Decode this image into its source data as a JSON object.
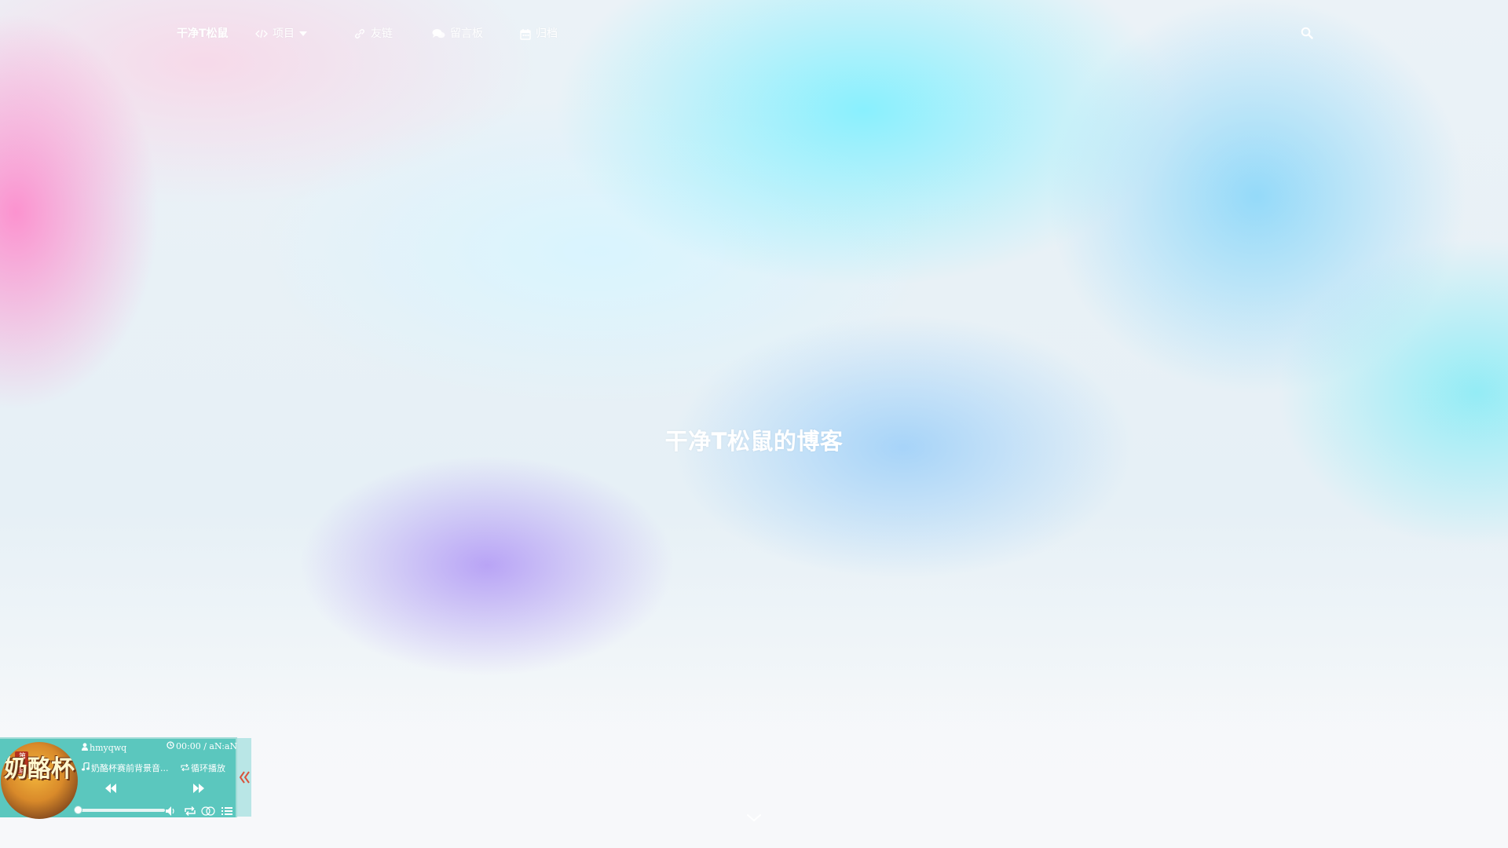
{
  "nav": {
    "brand": "干净T松鼠",
    "items": [
      {
        "label": "项目",
        "icon": "code-icon",
        "has_dropdown": true
      },
      {
        "label": "友链",
        "icon": "link-icon"
      },
      {
        "label": "留言板",
        "icon": "comments-icon"
      },
      {
        "label": "归档",
        "icon": "calendar-icon"
      }
    ],
    "search_icon": "search-icon"
  },
  "hero": {
    "title": "干净T松鼠的博客"
  },
  "player": {
    "cover_text": "奶酪杯",
    "cover_tag": "第五届",
    "artist": "hmyqwq",
    "time": "00:00 / aN:aN",
    "song": "奶酪杯赛前背景音...",
    "play_mode": "循环播放",
    "progress": 0,
    "accent_color": "#5bc7be",
    "toggle_color": "#d9533c"
  },
  "colors": {
    "nav_text": "#ffffff",
    "hero_text": "#ffffff"
  }
}
